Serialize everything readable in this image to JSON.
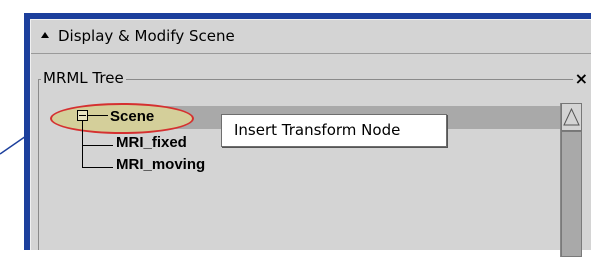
{
  "section": {
    "title": "Display & Modify Scene",
    "toggle_icon": "collapse-triangle-icon"
  },
  "mrml_tree": {
    "frame_label": "MRML Tree",
    "close_label": "×",
    "root": "Scene",
    "children": [
      "MRI_fixed",
      "MRI_moving"
    ]
  },
  "context_menu": {
    "item": "Insert Transform Node"
  },
  "colors": {
    "window_border": "#1c3f9c",
    "highlight_ring": "#d53030",
    "highlight_fill": "#d4cf9a",
    "selected_row": "#a9a9a9"
  }
}
